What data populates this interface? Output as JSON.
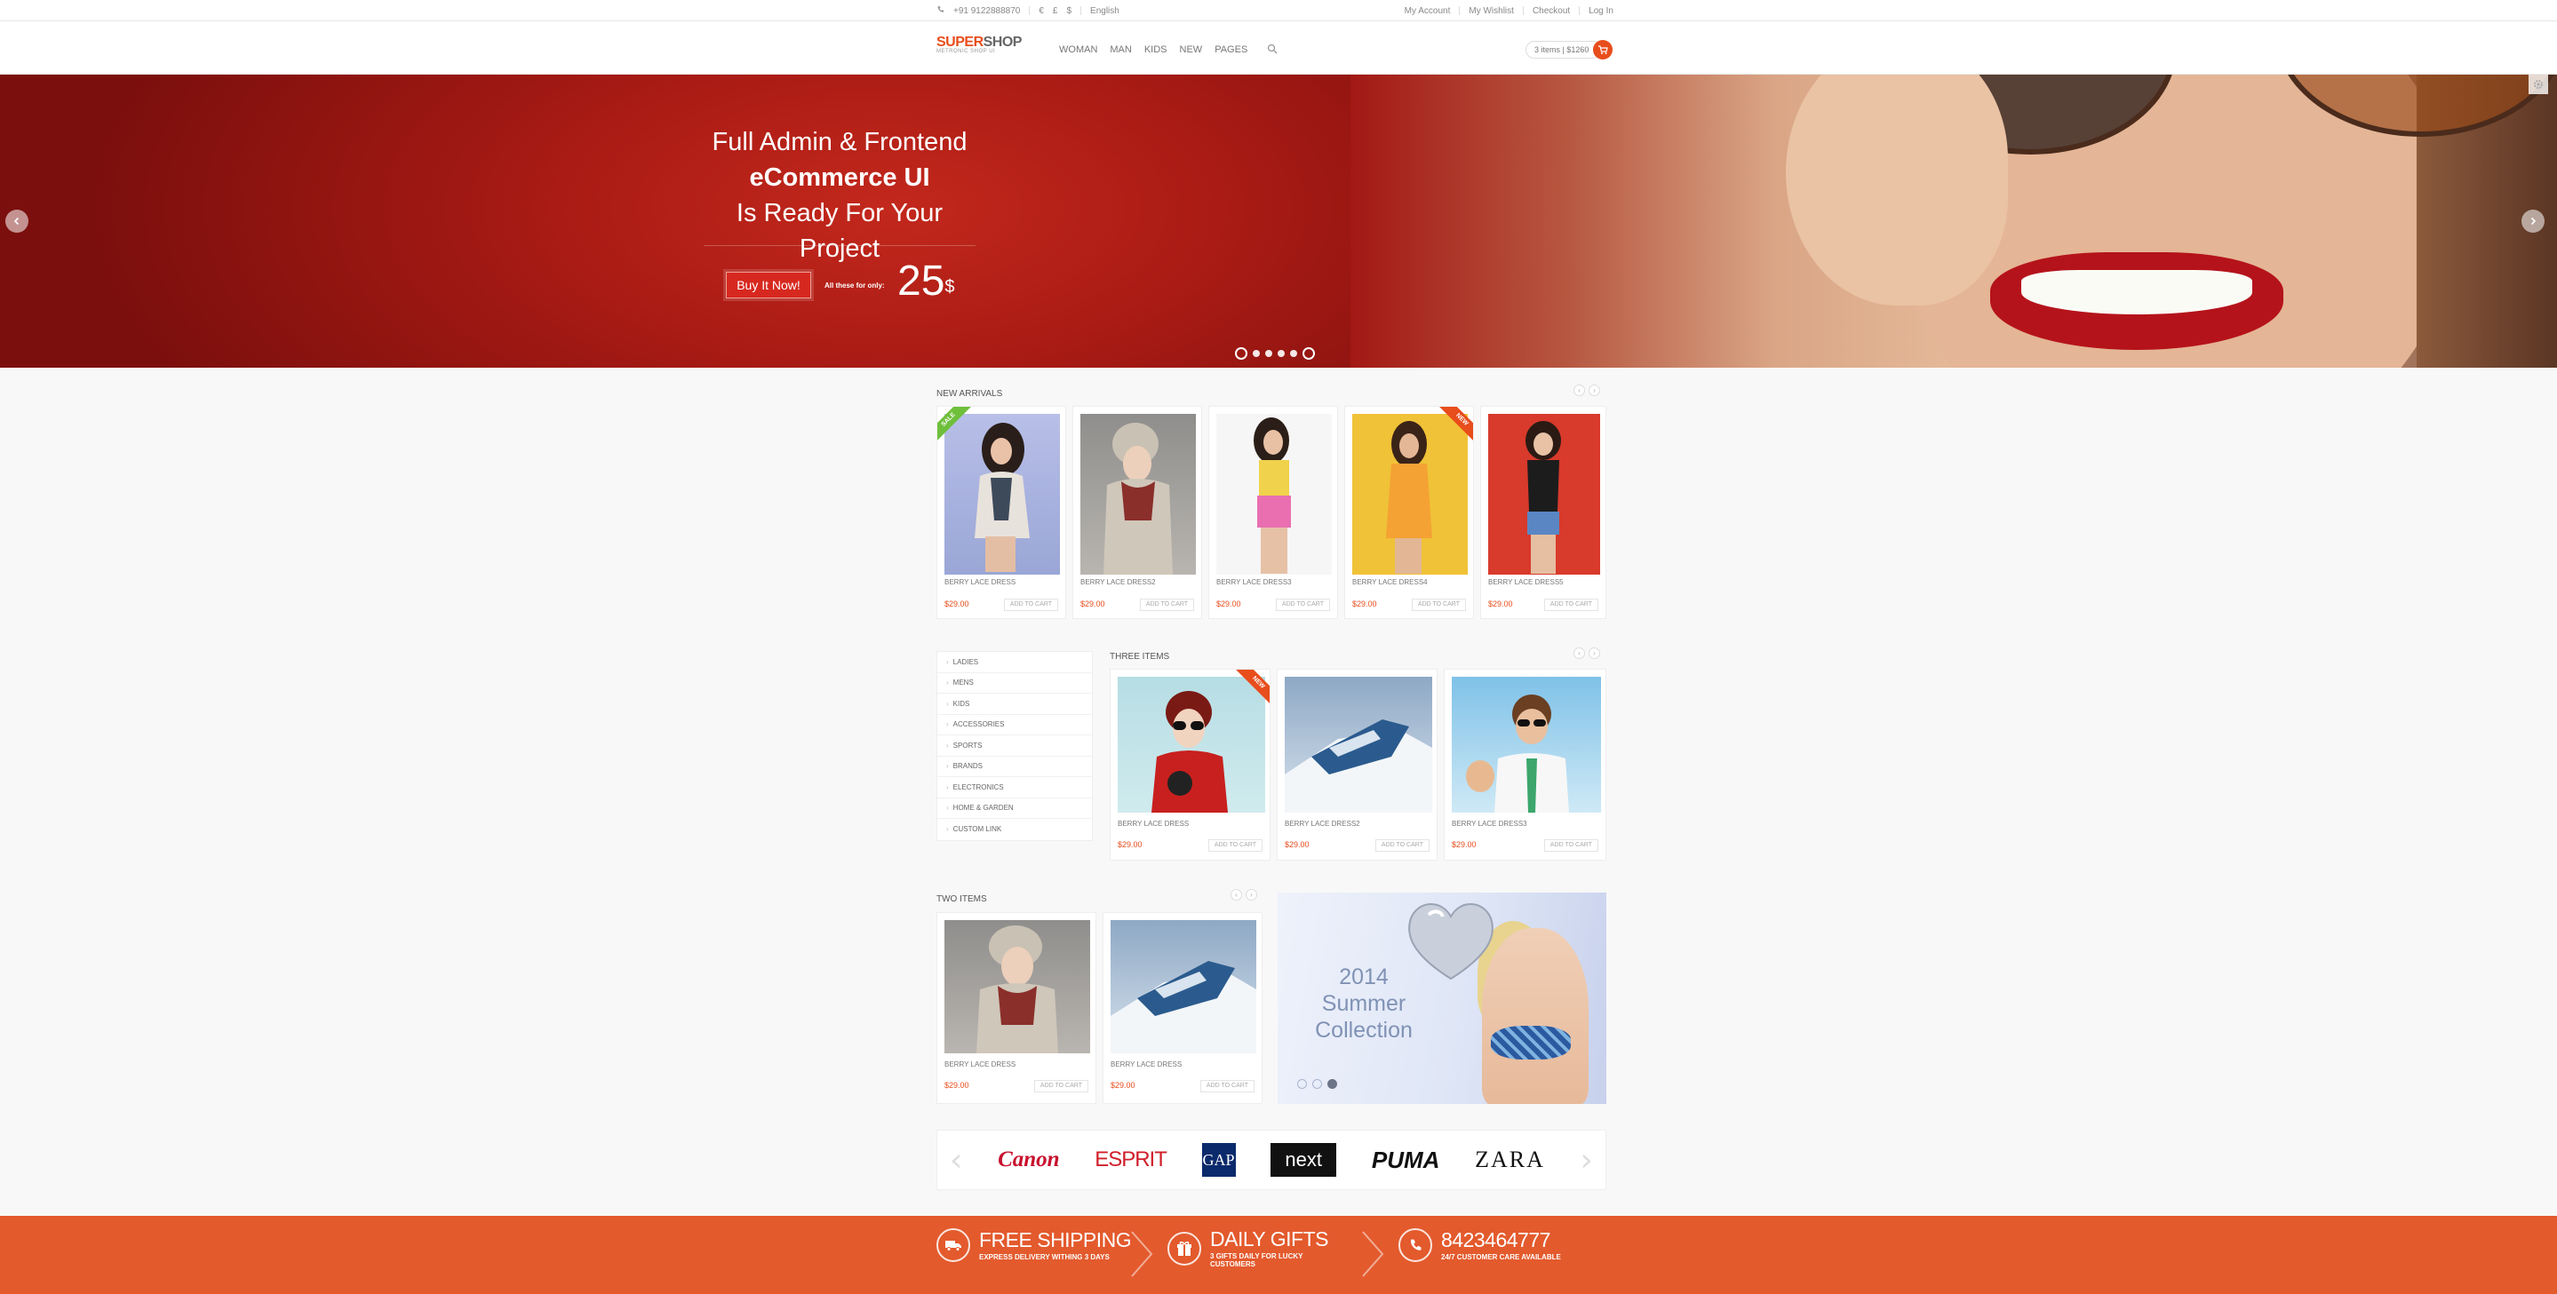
{
  "topbar": {
    "phone": "+91 9122888870",
    "currencies": [
      "€",
      "£",
      "$"
    ],
    "language": "English",
    "links": [
      "My Account",
      "My Wishlist",
      "Checkout",
      "Log In"
    ]
  },
  "header": {
    "logo_a": "SUPER",
    "logo_b": "SHOP",
    "logo_tag": "METRONIC SHOP UI",
    "nav": [
      "WOMAN",
      "MAN",
      "KIDS",
      "NEW",
      "PAGES"
    ],
    "cart_summary": "3 items | $1260"
  },
  "hero": {
    "line1": "Full Admin & Frontend",
    "line2": "eCommerce UI",
    "line3": "Is Ready For Your Project",
    "cta": "Buy It Now!",
    "for_label": "All these for only:",
    "price": "25",
    "price_unit": "$"
  },
  "new_arrivals": {
    "title": "NEW ARRIVALS",
    "items": [
      {
        "name": "BERRY LACE DRESS",
        "price": "$29.00",
        "add": "ADD TO CART",
        "ribbon": "SALE"
      },
      {
        "name": "BERRY LACE DRESS2",
        "price": "$29.00",
        "add": "ADD TO CART",
        "ribbon": ""
      },
      {
        "name": "BERRY LACE DRESS3",
        "price": "$29.00",
        "add": "ADD TO CART",
        "ribbon": ""
      },
      {
        "name": "BERRY LACE DRESS4",
        "price": "$29.00",
        "add": "ADD TO CART",
        "ribbon": "NEW"
      },
      {
        "name": "BERRY LACE DRESS5",
        "price": "$29.00",
        "add": "ADD TO CART",
        "ribbon": ""
      }
    ]
  },
  "categories": [
    "LADIES",
    "MENS",
    "KIDS",
    "ACCESSORIES",
    "SPORTS",
    "BRANDS",
    "ELECTRONICS",
    "HOME & GARDEN",
    "CUSTOM LINK"
  ],
  "three_items": {
    "title": "THREE ITEMS",
    "items": [
      {
        "name": "BERRY LACE DRESS",
        "price": "$29.00",
        "add": "ADD TO CART",
        "ribbon": "NEW"
      },
      {
        "name": "BERRY LACE DRESS2",
        "price": "$29.00",
        "add": "ADD TO CART",
        "ribbon": ""
      },
      {
        "name": "BERRY LACE DRESS3",
        "price": "$29.00",
        "add": "ADD TO CART",
        "ribbon": ""
      }
    ]
  },
  "two_items": {
    "title": "TWO ITEMS",
    "items": [
      {
        "name": "BERRY LACE DRESS",
        "price": "$29.00",
        "add": "ADD TO CART"
      },
      {
        "name": "BERRY LACE DRESS",
        "price": "$29.00",
        "add": "ADD TO CART"
      }
    ]
  },
  "promo": {
    "line1": "2014",
    "line2": "Summer",
    "line3": "Collection"
  },
  "brands": [
    "Canon",
    "ESPRIT",
    "GAP",
    "next",
    "PUMA",
    "ZARA"
  ],
  "footer": [
    {
      "title": "FREE SHIPPING",
      "sub": "EXPRESS DELIVERY WITHING 3 DAYS",
      "icon": "truck-icon"
    },
    {
      "title": "DAILY GIFTS",
      "sub": "3 GIFTS DAILY FOR LUCKY CUSTOMERS",
      "icon": "gift-icon"
    },
    {
      "title": "8423464777",
      "sub": "24/7 CUSTOMER CARE AVAILABLE",
      "icon": "phone-icon"
    }
  ],
  "colors": {
    "accent": "#e84d1c",
    "hero_red": "#a71a14",
    "footer": "#e35a2d",
    "sale": "#6fbf3b"
  }
}
